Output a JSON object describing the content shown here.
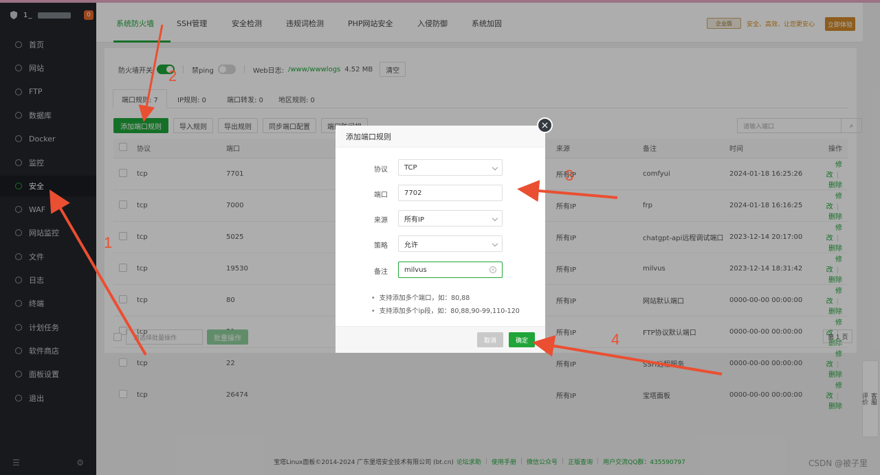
{
  "sidebar": {
    "user": "1_",
    "badge": "0",
    "items": [
      {
        "label": "首页",
        "icon": "home-icon"
      },
      {
        "label": "网站",
        "icon": "globe-icon"
      },
      {
        "label": "FTP",
        "icon": "ftp-icon"
      },
      {
        "label": "数据库",
        "icon": "database-icon"
      },
      {
        "label": "Docker",
        "icon": "docker-icon"
      },
      {
        "label": "监控",
        "icon": "monitor-icon"
      },
      {
        "label": "安全",
        "icon": "shield-icon",
        "active": true
      },
      {
        "label": "WAF",
        "icon": "waf-icon"
      },
      {
        "label": "网站监控",
        "icon": "chart-icon"
      },
      {
        "label": "文件",
        "icon": "folder-icon"
      },
      {
        "label": "日志",
        "icon": "log-icon"
      },
      {
        "label": "终端",
        "icon": "terminal-icon"
      },
      {
        "label": "计划任务",
        "icon": "clock-icon"
      },
      {
        "label": "软件商店",
        "icon": "store-icon"
      },
      {
        "label": "面板设置",
        "icon": "gear-icon"
      },
      {
        "label": "退出",
        "icon": "logout-icon"
      }
    ]
  },
  "tabs": [
    "系统防火墙",
    "SSH管理",
    "安全检测",
    "违规词检测",
    "PHP网站安全",
    "入侵防御",
    "系统加固"
  ],
  "header": {
    "enterprise": "企业版",
    "slogan": "安全、高效、让您更安心",
    "trial": "立即体验"
  },
  "firewall": {
    "switch_label": "防火墙开关",
    "ping_label": "禁ping",
    "weblog_label": "Web日志:",
    "weblog_path": "/www/wwwlogs",
    "weblog_size": "4.52 MB",
    "clear_label": "清空"
  },
  "subtabs": [
    "端口规则: 7",
    "IP规则: 0",
    "端口转发: 0",
    "地区规则: 0"
  ],
  "toolbar": [
    "添加端口规则",
    "导入规则",
    "导出规则",
    "同步端口配置",
    "端口防问规"
  ],
  "search_placeholder": "请输入端口",
  "table": {
    "headers": [
      "协议",
      "端口",
      "",
      "来源",
      "备注",
      "时间",
      "操作"
    ],
    "rows": [
      {
        "proto": "tcp",
        "port": "7701",
        "source": "所有IP",
        "note": "comfyui",
        "time": "2024-01-18 16:25:26"
      },
      {
        "proto": "tcp",
        "port": "7000",
        "source": "所有IP",
        "note": "frp",
        "time": "2024-01-18 16:16:25"
      },
      {
        "proto": "tcp",
        "port": "5025",
        "source": "所有IP",
        "note": "chatgpt-api远程调试端口",
        "time": "2023-12-14 20:17:00"
      },
      {
        "proto": "tcp",
        "port": "19530",
        "source": "所有IP",
        "note": "milvus",
        "time": "2023-12-14 18:31:42"
      },
      {
        "proto": "tcp",
        "port": "80",
        "source": "所有IP",
        "note": "网站默认端口",
        "time": "0000-00-00 00:00:00"
      },
      {
        "proto": "tcp",
        "port": "21",
        "source": "所有IP",
        "note": "FTP协议默认端口",
        "time": "0000-00-00 00:00:00"
      },
      {
        "proto": "tcp",
        "port": "22",
        "source": "所有IP",
        "note": "SSH远程服务",
        "time": "0000-00-00 00:00:00"
      },
      {
        "proto": "tcp",
        "port": "26474",
        "source": "所有IP",
        "note": "宝塔面板",
        "time": "0000-00-00 00:00:00"
      }
    ],
    "edit_label": "修改",
    "delete_label": "删除"
  },
  "batch": {
    "select_placeholder": "请选择批量操作",
    "button": "批量操作"
  },
  "pager": "第 1 页",
  "modal": {
    "title": "添加端口规则",
    "fields": [
      {
        "label": "协议",
        "value": "TCP",
        "type": "select"
      },
      {
        "label": "端口",
        "value": "7702",
        "type": "input"
      },
      {
        "label": "来源",
        "value": "所有IP",
        "type": "select"
      },
      {
        "label": "策略",
        "value": "允许",
        "type": "select"
      },
      {
        "label": "备注",
        "value": "milvus",
        "type": "input"
      }
    ],
    "tips": [
      "支持添加多个端口，如：80,88",
      "支持添加多个ip段，如：80,88,90-99,110-120"
    ],
    "cancel": "取消",
    "confirm": "确定"
  },
  "footer": {
    "copyright": "宝塔Linux面板©2014-2024 广东堡塔安全技术有限公司 (bt.cn)",
    "links": [
      "论坛求助",
      "使用手册",
      "微信公众号",
      "正版查询",
      "用户交流QQ群：435590797"
    ]
  },
  "float": [
    "客服",
    "评价"
  ],
  "watermark": "CSDN @被子里",
  "annotations": [
    "1",
    "2",
    "3",
    "4"
  ],
  "colors": {
    "accent": "#20a53a",
    "sidebar": "#22262b",
    "arrow": "#ea4f31"
  }
}
